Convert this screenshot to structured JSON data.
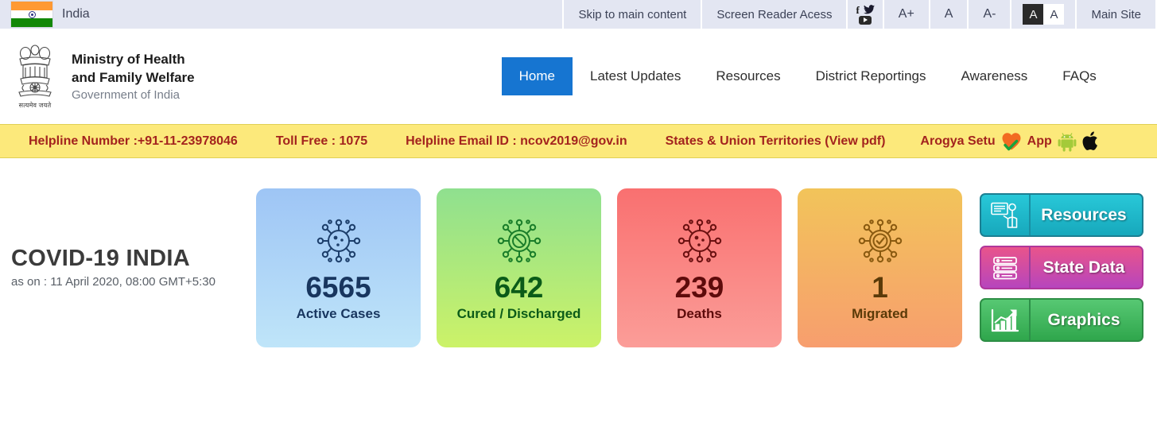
{
  "utility_bar": {
    "country": "India",
    "flag_icon": "india-flag-icon",
    "skip_link": "Skip to main content",
    "screen_reader": "Screen Reader Acess",
    "social": {
      "facebook": "facebook-icon",
      "twitter": "twitter-icon",
      "youtube": "youtube-icon"
    },
    "font_increase": "A+",
    "font_normal": "A",
    "font_decrease": "A-",
    "contrast_dark": "A",
    "contrast_light": "A",
    "main_site": "Main Site"
  },
  "header": {
    "emblem_icon": "ashoka-emblem-icon",
    "motto": "सत्यमेव जयते",
    "ministry_line1": "Ministry of Health",
    "ministry_line2": "and Family Welfare",
    "government": "Government of India",
    "nav": [
      {
        "label": "Home",
        "active": true
      },
      {
        "label": "Latest Updates",
        "active": false
      },
      {
        "label": "Resources",
        "active": false
      },
      {
        "label": "District Reportings",
        "active": false
      },
      {
        "label": "Awareness",
        "active": false
      },
      {
        "label": "FAQs",
        "active": false
      }
    ]
  },
  "helpline": {
    "number": "Helpline Number :+91-11-23978046",
    "toll_free": "Toll Free : 1075",
    "email": "Helpline Email ID : ncov2019@gov.in",
    "states_pdf": "States & Union Territories (View pdf)",
    "arogya_prefix": "Arogya Setu",
    "arogya_suffix": "App",
    "arogya_logo_icon": "arogya-setu-heart-check-icon",
    "android_icon": "android-icon",
    "apple_icon": "apple-icon",
    "bg_color": "#fce97b",
    "text_color": "#a3231e"
  },
  "dashboard": {
    "title": "COVID-19 INDIA",
    "as_on": "as on : 11 April 2020, 08:00 GMT+5:30",
    "cards": [
      {
        "value": "6565",
        "label": "Active Cases",
        "icon": "virus-icon",
        "key": "active"
      },
      {
        "value": "642",
        "label": "Cured / Discharged",
        "icon": "virus-blocked-icon",
        "key": "cured"
      },
      {
        "value": "239",
        "label": "Deaths",
        "icon": "virus-icon",
        "key": "deaths"
      },
      {
        "value": "1",
        "label": "Migrated",
        "icon": "virus-check-icon",
        "key": "migrated"
      }
    ],
    "side_buttons": [
      {
        "label": "Resources",
        "icon": "presenter-board-icon",
        "color": "#17a8bc"
      },
      {
        "label": "State Data",
        "icon": "database-server-icon",
        "color": "#b745bd"
      },
      {
        "label": "Graphics",
        "icon": "bar-chart-growth-icon",
        "color": "#2fa64c"
      }
    ]
  }
}
